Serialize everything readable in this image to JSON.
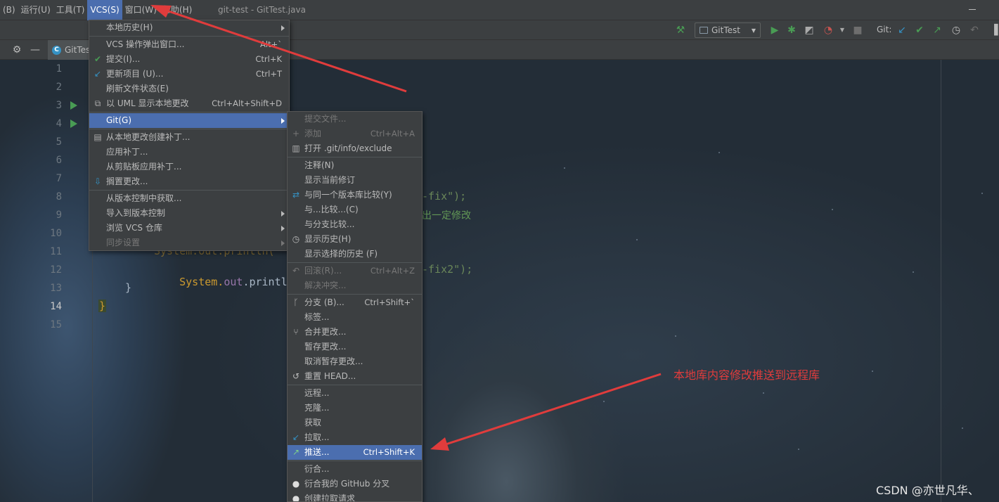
{
  "menubar": {
    "items": [
      "(B)",
      "运行(U)",
      "工具(T)",
      "VCS(S)",
      "窗口(W)",
      "帮助(H)"
    ],
    "active_index": 3,
    "window_title": "git-test - GitTest.java"
  },
  "toolbar": {
    "run_config": "GitTest",
    "git_label": "Git:"
  },
  "editor": {
    "tab_label": "GitTest",
    "line_numbers": [
      "1",
      "2",
      "3",
      "4",
      "5",
      "6",
      "7",
      "8",
      "9",
      "10",
      "11",
      "12",
      "13",
      "14",
      "15"
    ],
    "current_line": "14",
    "code": {
      "line8_tail": "-fix\");",
      "line9_comment": "出一定修改",
      "line11": "System.out.println(",
      "line12_prefix": "System.",
      "line12_out": "out",
      "line12_mid": ".println(",
      "line12_tail": "-fix2\");",
      "line13": "}",
      "line14": "}"
    }
  },
  "vcs_menu": {
    "items": [
      {
        "label": "本地历史(H)",
        "submenu": true
      },
      {
        "label": "VCS 操作弹出窗口...",
        "shortcut": "Alt+`"
      },
      {
        "label": "提交(I)...",
        "shortcut": "Ctrl+K",
        "icon": "check-icon"
      },
      {
        "label": "更新项目 (U)...",
        "shortcut": "Ctrl+T",
        "icon": "update-arrow-icon"
      },
      {
        "label": "刷新文件状态(E)"
      },
      {
        "label": "以 UML 显示本地更改",
        "shortcut": "Ctrl+Alt+Shift+D",
        "icon": "uml-icon"
      },
      {
        "label": "Git(G)",
        "submenu": true,
        "selected": true
      },
      {
        "label": "从本地更改创建补丁...",
        "icon": "patch-icon"
      },
      {
        "label": "应用补丁..."
      },
      {
        "label": "从剪贴板应用补丁..."
      },
      {
        "label": "搁置更改...",
        "icon": "shelve-icon"
      },
      {
        "label": "从版本控制中获取..."
      },
      {
        "label": "导入到版本控制",
        "submenu": true
      },
      {
        "label": "浏览 VCS 仓库",
        "submenu": true
      },
      {
        "label": "同步设置",
        "disabled": true,
        "submenu": true
      }
    ]
  },
  "git_menu": {
    "items": [
      {
        "label": "提交文件...",
        "disabled": true
      },
      {
        "label": "添加",
        "shortcut": "Ctrl+Alt+A",
        "disabled": true,
        "icon": "plus-icon"
      },
      {
        "label": "打开 .git/info/exclude",
        "icon": "file-icon"
      },
      {
        "label": "注释(N)"
      },
      {
        "label": "显示当前修订"
      },
      {
        "label": "与同一个版本库比较(Y)",
        "icon": "compare-icon"
      },
      {
        "label": "与...比较...(C)"
      },
      {
        "label": "与分支比较..."
      },
      {
        "label": "显示历史(H)",
        "icon": "clock-icon"
      },
      {
        "label": "显示选择的历史 (F)"
      },
      {
        "label": "回滚(R)...",
        "shortcut": "Ctrl+Alt+Z",
        "disabled": true,
        "icon": "rollback-icon"
      },
      {
        "label": "解决冲突...",
        "disabled": true
      },
      {
        "label": "分支 (B)...",
        "shortcut": "Ctrl+Shift+`",
        "icon": "branch-icon"
      },
      {
        "label": "标签..."
      },
      {
        "label": "合并更改...",
        "icon": "merge-icon"
      },
      {
        "label": "暂存更改..."
      },
      {
        "label": "取消暂存更改..."
      },
      {
        "label": "重置 HEAD...",
        "icon": "reset-icon"
      },
      {
        "label": "远程..."
      },
      {
        "label": "克隆..."
      },
      {
        "label": "获取"
      },
      {
        "label": "拉取...",
        "icon": "pull-icon"
      },
      {
        "label": "推送...",
        "shortcut": "Ctrl+Shift+K",
        "selected": true,
        "icon": "push-icon"
      },
      {
        "label": "衍合..."
      },
      {
        "label": "衍合我的 GitHub 分叉",
        "icon": "github-icon"
      },
      {
        "label": "创建拉取请求",
        "icon": "github-icon"
      }
    ]
  },
  "annotation": {
    "text": "本地库内容修改推送到远程库",
    "color": "#e03c3c"
  },
  "watermark": "CSDN @亦世凡华、",
  "colors": {
    "selection": "#4b6eaf",
    "menu_bg": "#3c3f41",
    "string": "#6a8759",
    "keyword_yellow": "#cc9a2f"
  }
}
